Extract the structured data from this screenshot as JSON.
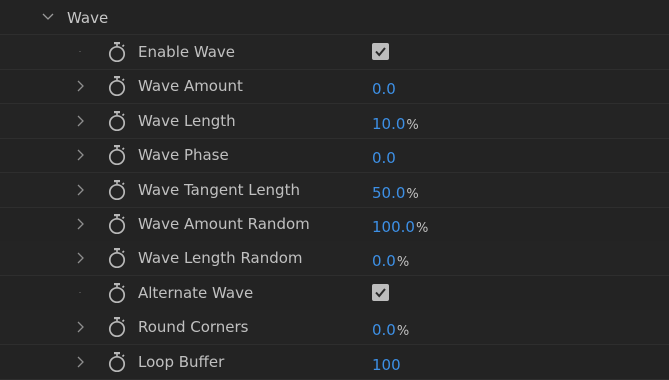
{
  "group": {
    "label": "Wave",
    "expanded": true
  },
  "properties": [
    {
      "label": "Enable Wave",
      "type": "checkbox",
      "checked": true
    },
    {
      "label": "Wave Amount",
      "type": "number",
      "value": "0.0",
      "unit": ""
    },
    {
      "label": "Wave Length",
      "type": "number",
      "value": "10.0",
      "unit": "%"
    },
    {
      "label": "Wave Phase",
      "type": "number",
      "value": "0.0",
      "unit": ""
    },
    {
      "label": "Wave Tangent Length",
      "type": "number",
      "value": "50.0",
      "unit": "%"
    },
    {
      "label": "Wave Amount Random",
      "type": "number",
      "value": "100.0",
      "unit": "%"
    },
    {
      "label": "Wave Length Random",
      "type": "number",
      "value": "0.0",
      "unit": "%"
    },
    {
      "label": "Alternate Wave",
      "type": "checkbox",
      "checked": true
    },
    {
      "label": "Round Corners",
      "type": "number",
      "value": "0.0",
      "unit": "%"
    },
    {
      "label": "Loop Buffer",
      "type": "number",
      "value": "100",
      "unit": ""
    }
  ],
  "icons": {
    "group_toggle": "chevron-down-icon",
    "row_toggle": "chevron-right-icon",
    "keyframe": "stopwatch-icon",
    "check": "checkmark-icon"
  },
  "colors": {
    "value": "#3d90e6",
    "label": "#c0c0c0",
    "background": "#232323"
  }
}
